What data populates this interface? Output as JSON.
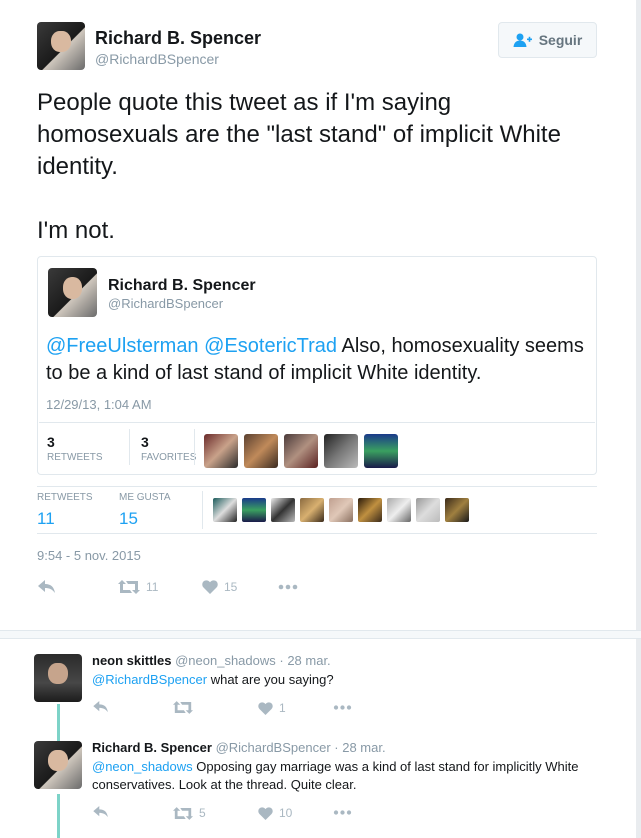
{
  "main_tweet": {
    "author_name": "Richard B. Spencer",
    "author_handle": "@RichardBSpencer",
    "follow_label": "Seguir",
    "text": "People quote this tweet as if I'm saying homosexuals are the \"last stand\" of implicit White identity.\n\nI'm not.",
    "retweets_label": "RETWEETS",
    "retweets": "11",
    "likes_label": "ME GUSTA",
    "likes": "15",
    "timestamp": "9:54 - 5 nov. 2015",
    "action_retweet_count": "11",
    "action_like_count": "15"
  },
  "quoted_tweet": {
    "author_name": "Richard B. Spencer",
    "author_handle": "@RichardBSpencer",
    "mention1": "@FreeUlsterman",
    "mention2": "@EsotericTrad",
    "text": " Also, homosexuality seems to be a kind of last stand of implicit White identity.",
    "timestamp": "12/29/13, 1:04 AM",
    "retweets": "3",
    "retweets_label": "RETWEETS",
    "favorites": "3",
    "favorites_label": "FAVORITES"
  },
  "replies": [
    {
      "author_name": "neon skittles",
      "author_handle": "@neon_shadows",
      "date": "· 28 mar.",
      "mention": "@RichardBSpencer",
      "text": " what are you saying?",
      "retweet_count": "",
      "like_count": "1"
    },
    {
      "author_name": "Richard B. Spencer",
      "author_handle": "@RichardBSpencer",
      "date": "· 28 mar.",
      "mention": "@neon_shadows",
      "text": "  Opposing gay marriage was a kind of last stand for implicitly White conservatives. Look at the thread. Quite clear.",
      "retweet_count": "5",
      "like_count": "10"
    }
  ],
  "colors": {
    "link": "#1da1f2",
    "muted": "#8899a6",
    "thread_line": "#7dd3c8"
  },
  "icons": [
    "follow-user-icon",
    "reply-icon",
    "retweet-icon",
    "heart-icon",
    "more-icon"
  ]
}
